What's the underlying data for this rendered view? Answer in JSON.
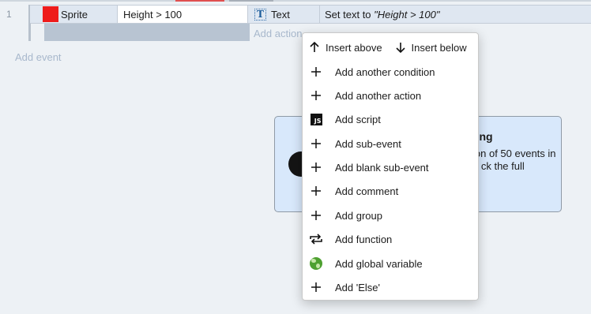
{
  "event": {
    "row_number": "1",
    "condition_object": "Sprite",
    "condition_text": "Height > 100",
    "action_object": "Text",
    "action_text_prefix": "Set text to ",
    "action_text_value": "\"Height > 100\"",
    "add_action_label": "Add action",
    "add_event_label": "Add event",
    "sprite_color": "#ee1b1b"
  },
  "dialog": {
    "title_fragment": "ning",
    "body_fragment": "ion of 50 events in a ck the full"
  },
  "context_menu": {
    "insert_above": "Insert above",
    "insert_below": "Insert below",
    "items": [
      {
        "label": "Add another condition",
        "icon": "plus-icon"
      },
      {
        "label": "Add another action",
        "icon": "plus-icon"
      },
      {
        "label": "Add script",
        "icon": "js-icon"
      },
      {
        "label": "Add sub-event",
        "icon": "plus-icon"
      },
      {
        "label": "Add blank sub-event",
        "icon": "plus-icon"
      },
      {
        "label": "Add comment",
        "icon": "plus-icon"
      },
      {
        "label": "Add group",
        "icon": "plus-icon"
      },
      {
        "label": "Add function",
        "icon": "repeat-arrows-icon"
      },
      {
        "label": "Add global variable",
        "icon": "globe-icon"
      },
      {
        "label": "Add 'Else'",
        "icon": "plus-icon"
      }
    ],
    "js_badge": "JS"
  }
}
